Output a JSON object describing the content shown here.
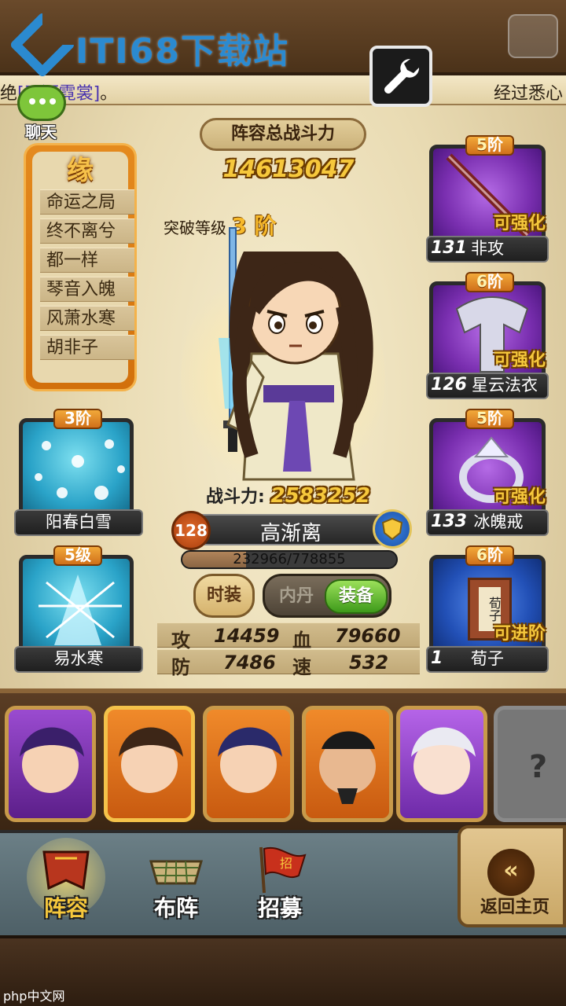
{
  "watermark": {
    "text": "ITI68下载站"
  },
  "ticker": {
    "left_prefix": "绝",
    "left_highlight": "[天河霓裳]",
    "left_suffix": "。",
    "right_text": "经过悉心"
  },
  "chat": {
    "label": "聊天"
  },
  "yuan": {
    "title": "缘",
    "items": [
      {
        "label": "命运之局"
      },
      {
        "label": "终不离兮"
      },
      {
        "label": "都一样"
      },
      {
        "label": "琴音入魄"
      },
      {
        "label": "风萧水寒"
      },
      {
        "label": "胡非子"
      }
    ]
  },
  "lineup": {
    "title": "阵容总战斗力",
    "total_power": "14613047"
  },
  "hero": {
    "breakthrough_label": "突破等级",
    "breakthrough_level": "3 阶",
    "power_label": "战斗力:",
    "power_value": "2583252",
    "level": "128",
    "name": "高渐离",
    "exp_text": "232966/778855",
    "exp_fraction": 0.299,
    "tabs": {
      "fashion": "时装",
      "neidan": "内丹",
      "equip": "装备"
    },
    "stats": {
      "atk_label": "攻",
      "atk": "14459",
      "hp_label": "血",
      "hp": "79660",
      "def_label": "防",
      "def": "7486",
      "spd_label": "速",
      "spd": "532"
    }
  },
  "skills": [
    {
      "badge_num": "3",
      "badge_unit": "阶",
      "name": "阳春白雪"
    },
    {
      "badge_num": "5",
      "badge_unit": "级",
      "name": "易水寒"
    }
  ],
  "equipment": [
    {
      "badge_num": "5",
      "badge_unit": "阶",
      "count": "131",
      "name": "非攻",
      "status": "可强化"
    },
    {
      "badge_num": "6",
      "badge_unit": "阶",
      "count": "126",
      "name": "星云法衣",
      "status": "可强化"
    },
    {
      "badge_num": "5",
      "badge_unit": "阶",
      "count": "133",
      "name": "冰魄戒",
      "status": "可强化"
    },
    {
      "badge_num": "6",
      "badge_unit": "阶",
      "count": "1",
      "name": "荀子",
      "status": "可进阶",
      "book_text": "荀子"
    }
  ],
  "roster": {
    "locked_symbol": "?"
  },
  "nav": {
    "lineup": "阵容",
    "formation": "布阵",
    "recruit": "招募",
    "recruit_flag_char": "招",
    "home": "返回主页",
    "home_arrows": "«"
  },
  "footer": {
    "site_mark": "php中文网"
  },
  "colors": {
    "gold": "#f6c83c",
    "green_tab": "#3e9a1a",
    "purple_card": "#7a2fb0",
    "blue_card": "#2250b6"
  }
}
